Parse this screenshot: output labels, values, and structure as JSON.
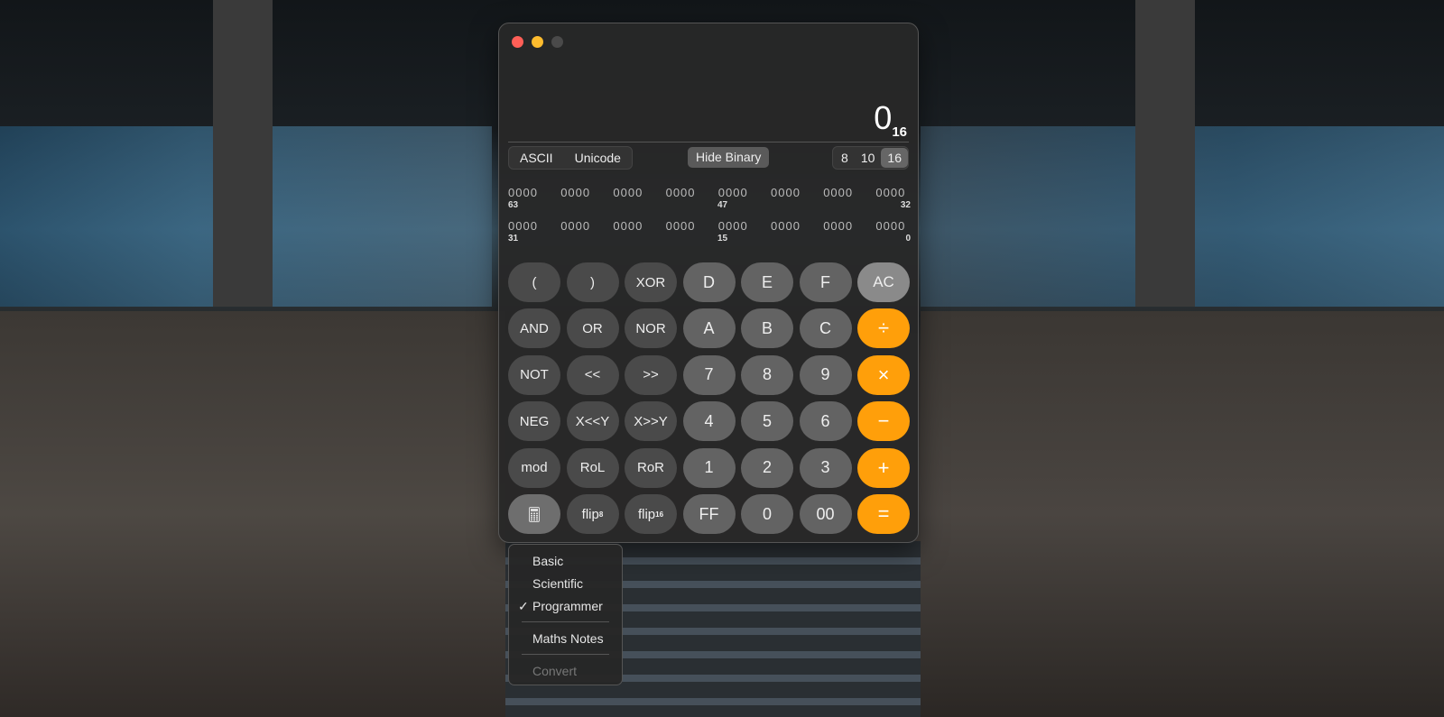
{
  "window": {
    "traffic_lights": {
      "close": "#ff5f57",
      "minimize": "#febc2e",
      "zoom": "#4a4a4a"
    }
  },
  "display": {
    "value": "0",
    "base_subscript": "16"
  },
  "toolbar": {
    "ascii": "ASCII",
    "unicode": "Unicode",
    "hide_binary": "Hide Binary",
    "bases": [
      "8",
      "10",
      "16"
    ],
    "selected_base": "16"
  },
  "binary": {
    "row1": {
      "groups": [
        "0000",
        "0000",
        "0000",
        "0000",
        "0000",
        "0000",
        "0000",
        "0000"
      ],
      "labels": [
        "63",
        "47",
        "32"
      ]
    },
    "row2": {
      "groups": [
        "0000",
        "0000",
        "0000",
        "0000",
        "0000",
        "0000",
        "0000",
        "0000"
      ],
      "labels": [
        "31",
        "15",
        "0"
      ]
    }
  },
  "keys": [
    [
      "(",
      ")",
      "XOR",
      "D",
      "E",
      "F",
      "AC"
    ],
    [
      "AND",
      "OR",
      "NOR",
      "A",
      "B",
      "C",
      "÷"
    ],
    [
      "NOT",
      "<<",
      ">>",
      "7",
      "8",
      "9",
      "×"
    ],
    [
      "NEG",
      "X<<Y",
      "X>>Y",
      "4",
      "5",
      "6",
      "−"
    ],
    [
      "mod",
      "RoL",
      "RoR",
      "1",
      "2",
      "3",
      "+"
    ],
    [
      "calculator-icon",
      "flip8",
      "flip16",
      "FF",
      "0",
      "00",
      "="
    ]
  ],
  "flip8": {
    "base": "flip",
    "sub": "8"
  },
  "flip16": {
    "base": "flip",
    "sub": "16"
  },
  "menu": {
    "items": [
      "Basic",
      "Scientific",
      "Programmer",
      "Maths Notes",
      "Convert"
    ],
    "checked": "Programmer",
    "check_mark": "✓"
  },
  "colors": {
    "accent": "#ff9f0a"
  }
}
